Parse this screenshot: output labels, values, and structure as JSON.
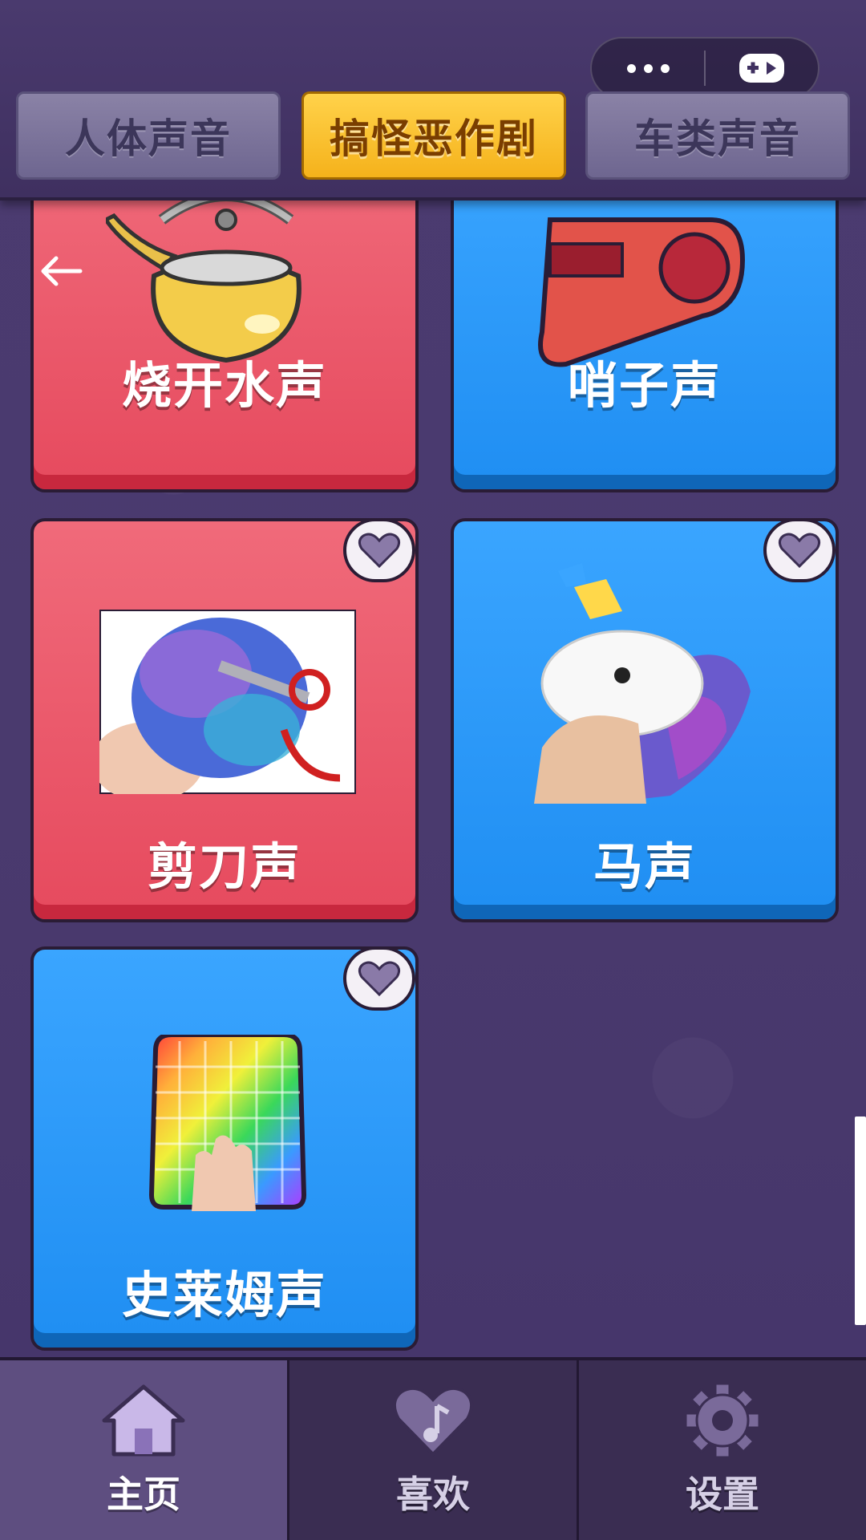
{
  "tabs": [
    {
      "label": "人体声音",
      "active": false
    },
    {
      "label": "搞怪恶作剧",
      "active": true
    },
    {
      "label": "车类声音",
      "active": false
    }
  ],
  "capsule": {
    "more_icon": "more-dots-icon",
    "game_icon": "gamepad-icon"
  },
  "cards": [
    {
      "label": "烧开水声",
      "color": "red",
      "icon": "kettle-icon",
      "favorite": false
    },
    {
      "label": "哨子声",
      "color": "blue",
      "icon": "whistle-icon",
      "favorite": false
    },
    {
      "label": "剪刀声",
      "color": "red",
      "icon": "scissors-icon",
      "favorite": true
    },
    {
      "label": "马声",
      "color": "blue",
      "icon": "unicorn-squishy-icon",
      "favorite": true
    },
    {
      "label": "史莱姆声",
      "color": "blue",
      "icon": "rainbow-slime-icon",
      "favorite": true
    }
  ],
  "nav": [
    {
      "label": "主页",
      "icon": "home-icon",
      "active": true
    },
    {
      "label": "喜欢",
      "icon": "heart-music-icon",
      "active": false
    },
    {
      "label": "设置",
      "icon": "gear-icon",
      "active": false
    }
  ],
  "colors": {
    "card_red": "#e64a5e",
    "card_blue": "#1f8ef2",
    "tab_active": "#f5b21b",
    "background": "#4a3a6e"
  }
}
